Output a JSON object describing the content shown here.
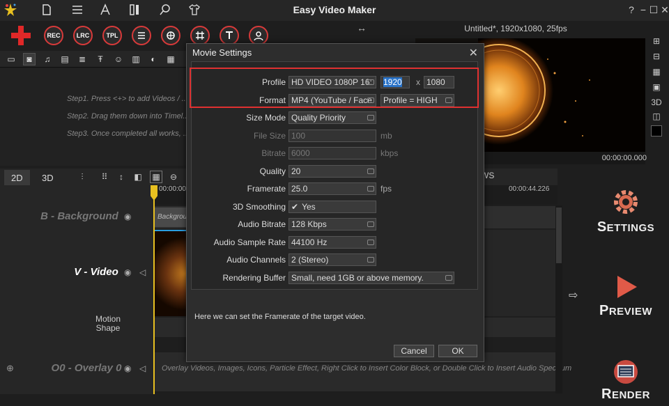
{
  "titlebar": {
    "app_title": "Easy Video Maker",
    "help": "?",
    "min": "−",
    "max": "☐",
    "close": "✕"
  },
  "toolbar": {
    "rec": "REC",
    "lrc": "LRC",
    "tpl": "TPL"
  },
  "steps": [
    "Step1. Press <+> to add Videos / ...",
    "Step2. Drag them down into Timel...",
    "Step3. Once completed all works, ..."
  ],
  "project": {
    "info": "Untitled*, 1920x1080, 25fps",
    "time": "00:00:00.000"
  },
  "timeline": {
    "tabs": [
      "2D",
      "3D"
    ],
    "views": "WS",
    "ruler_start": "00:00:00",
    "ruler_end": "00:00:44.226",
    "tracks": {
      "background": "B - Background",
      "video": "V - Video",
      "motion": "Motion",
      "shape": "Shape",
      "overlay": "O0 - Overlay 0"
    },
    "bg_clip": "Background",
    "overlay_hint": "Overlay Videos, Images, Icons, Particle Effect, Right Click to Insert Color Block, or Double Click to Insert Audio Spectrum"
  },
  "actions": {
    "settings_cap": "S",
    "settings_rest": "ETTINGS",
    "preview_cap": "P",
    "preview_rest": "REVIEW",
    "render_cap": "R",
    "render_rest": "ENDER"
  },
  "dialog": {
    "title": "Movie Settings",
    "profile_label": "Profile",
    "profile_value": "HD VIDEO 1080P 16:",
    "width": "1920",
    "x": "x",
    "height": "1080",
    "format_label": "Format",
    "format_value": "MP4 (YouTube / Face",
    "profile_level": "Profile = HIGH",
    "size_mode_label": "Size Mode",
    "size_mode_value": "Quality Priority",
    "file_size_label": "File Size",
    "file_size_value": "100",
    "file_size_unit": "mb",
    "bitrate_label": "Bitrate",
    "bitrate_value": "6000",
    "bitrate_unit": "kbps",
    "quality_label": "Quality",
    "quality_value": "20",
    "framerate_label": "Framerate",
    "framerate_value": "25.0",
    "framerate_unit": "fps",
    "smoothing_label": "3D Smoothing",
    "smoothing_value": "Yes",
    "audio_bitrate_label": "Audio Bitrate",
    "audio_bitrate_value": "128 Kbps",
    "sample_rate_label": "Audio Sample Rate",
    "sample_rate_value": "44100 Hz",
    "channels_label": "Audio Channels",
    "channels_value": "2 (Stereo)",
    "buffer_label": "Rendering Buffer",
    "buffer_value": "Small, need 1GB or above memory.",
    "help": "Here we can set the Framerate of the target video.",
    "cancel": "Cancel",
    "ok": "OK"
  },
  "colors": {
    "accent_red": "#d83a3a",
    "highlight": "#e03030",
    "playhead": "#e8c020",
    "selection": "#2a73c8"
  }
}
